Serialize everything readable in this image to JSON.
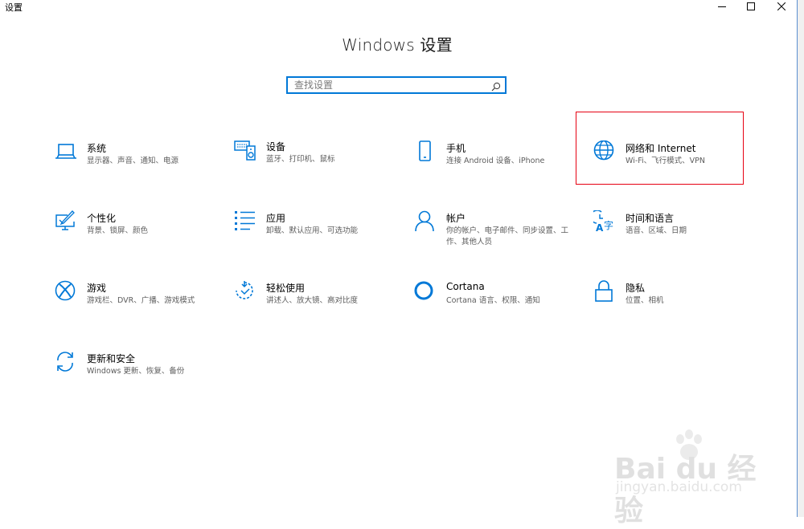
{
  "window": {
    "title": "设置",
    "controls": {
      "minimize": "minimize-icon",
      "maximize": "maximize-icon",
      "close": "close-icon"
    }
  },
  "header": {
    "title": "Windows 设置"
  },
  "search": {
    "placeholder": "查找设置",
    "value": "",
    "icon": "search-icon"
  },
  "accent_color": "#0078d7",
  "highlight_color": "#e60012",
  "tiles": [
    {
      "title": "系统",
      "desc": "显示器、声音、通知、电源",
      "icon": "laptop-icon"
    },
    {
      "title": "设备",
      "desc": "蓝牙、打印机、鼠标",
      "icon": "keyboard-speaker-icon"
    },
    {
      "title": "手机",
      "desc": "连接 Android 设备、iPhone",
      "icon": "phone-icon"
    },
    {
      "title": "网络和 Internet",
      "desc": "Wi-Fi、飞行模式、VPN",
      "icon": "globe-icon",
      "highlighted": true
    },
    {
      "title": "个性化",
      "desc": "背景、锁屏、颜色",
      "icon": "paintbrush-monitor-icon"
    },
    {
      "title": "应用",
      "desc": "卸载、默认应用、可选功能",
      "icon": "app-list-icon"
    },
    {
      "title": "帐户",
      "desc": "你的帐户、电子邮件、同步设置、工作、其他人员",
      "icon": "person-icon"
    },
    {
      "title": "时间和语言",
      "desc": "语音、区域、日期",
      "icon": "time-language-icon"
    },
    {
      "title": "游戏",
      "desc": "游戏栏、DVR、广播、游戏模式",
      "icon": "xbox-icon"
    },
    {
      "title": "轻松使用",
      "desc": "讲述人、放大镜、高对比度",
      "icon": "ease-of-access-icon"
    },
    {
      "title": "Cortana",
      "desc": "Cortana 语言、权限、通知",
      "icon": "cortana-ring-icon"
    },
    {
      "title": "隐私",
      "desc": "位置、相机",
      "icon": "padlock-icon"
    },
    {
      "title": "更新和安全",
      "desc": "Windows 更新、恢复、备份",
      "icon": "sync-arrows-icon"
    }
  ],
  "watermark": {
    "brand": "Bai du 经验",
    "url": "jingyan.baidu.com",
    "icon": "paw-icon"
  }
}
